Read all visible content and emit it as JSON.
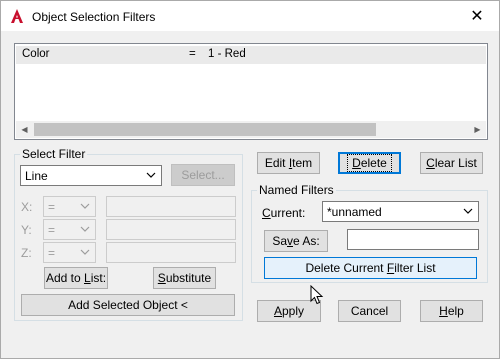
{
  "window": {
    "title": "Object Selection Filters",
    "close_glyph": "✕",
    "icon": "autocad-app-icon"
  },
  "filter_list": {
    "rows": [
      {
        "property": "Color",
        "operator": "=",
        "value": "1 - Red"
      }
    ]
  },
  "select_filter": {
    "group_label": "Select Filter",
    "type_value": "Line",
    "select_button": "Select...",
    "x_label": "X:",
    "y_label": "Y:",
    "z_label": "Z:",
    "x_op": "=",
    "y_op": "=",
    "z_op": "=",
    "add_to_list_pre": "Add to ",
    "add_to_list_key": "L",
    "add_to_list_post": "ist:",
    "substitute_key": "S",
    "substitute_post": "ubstitute",
    "add_selected": "Add Selected Object <"
  },
  "edit_buttons": {
    "edit_item_pre": "Edit ",
    "edit_item_key": "I",
    "edit_item_post": "tem",
    "delete_key": "D",
    "delete_post": "elete",
    "clear_list_pre": "",
    "clear_list_key": "C",
    "clear_list_post": "lear List"
  },
  "named_filters": {
    "group_label": "Named Filters",
    "current_key": "C",
    "current_post": "urrent:",
    "current_value": "*unnamed",
    "save_as_pre": "Sa",
    "save_as_key": "v",
    "save_as_post": "e As:",
    "save_as_input": "",
    "delete_current_pre": "Delete Current ",
    "delete_current_key": "F",
    "delete_current_post": "ilter List"
  },
  "footer": {
    "apply_key": "A",
    "apply_post": "pply",
    "cancel": "Cancel",
    "help_key": "H",
    "help_post": "elp"
  },
  "colors": {
    "focus_blue": "#0078d7",
    "app_icon_red": "#c8102e"
  }
}
